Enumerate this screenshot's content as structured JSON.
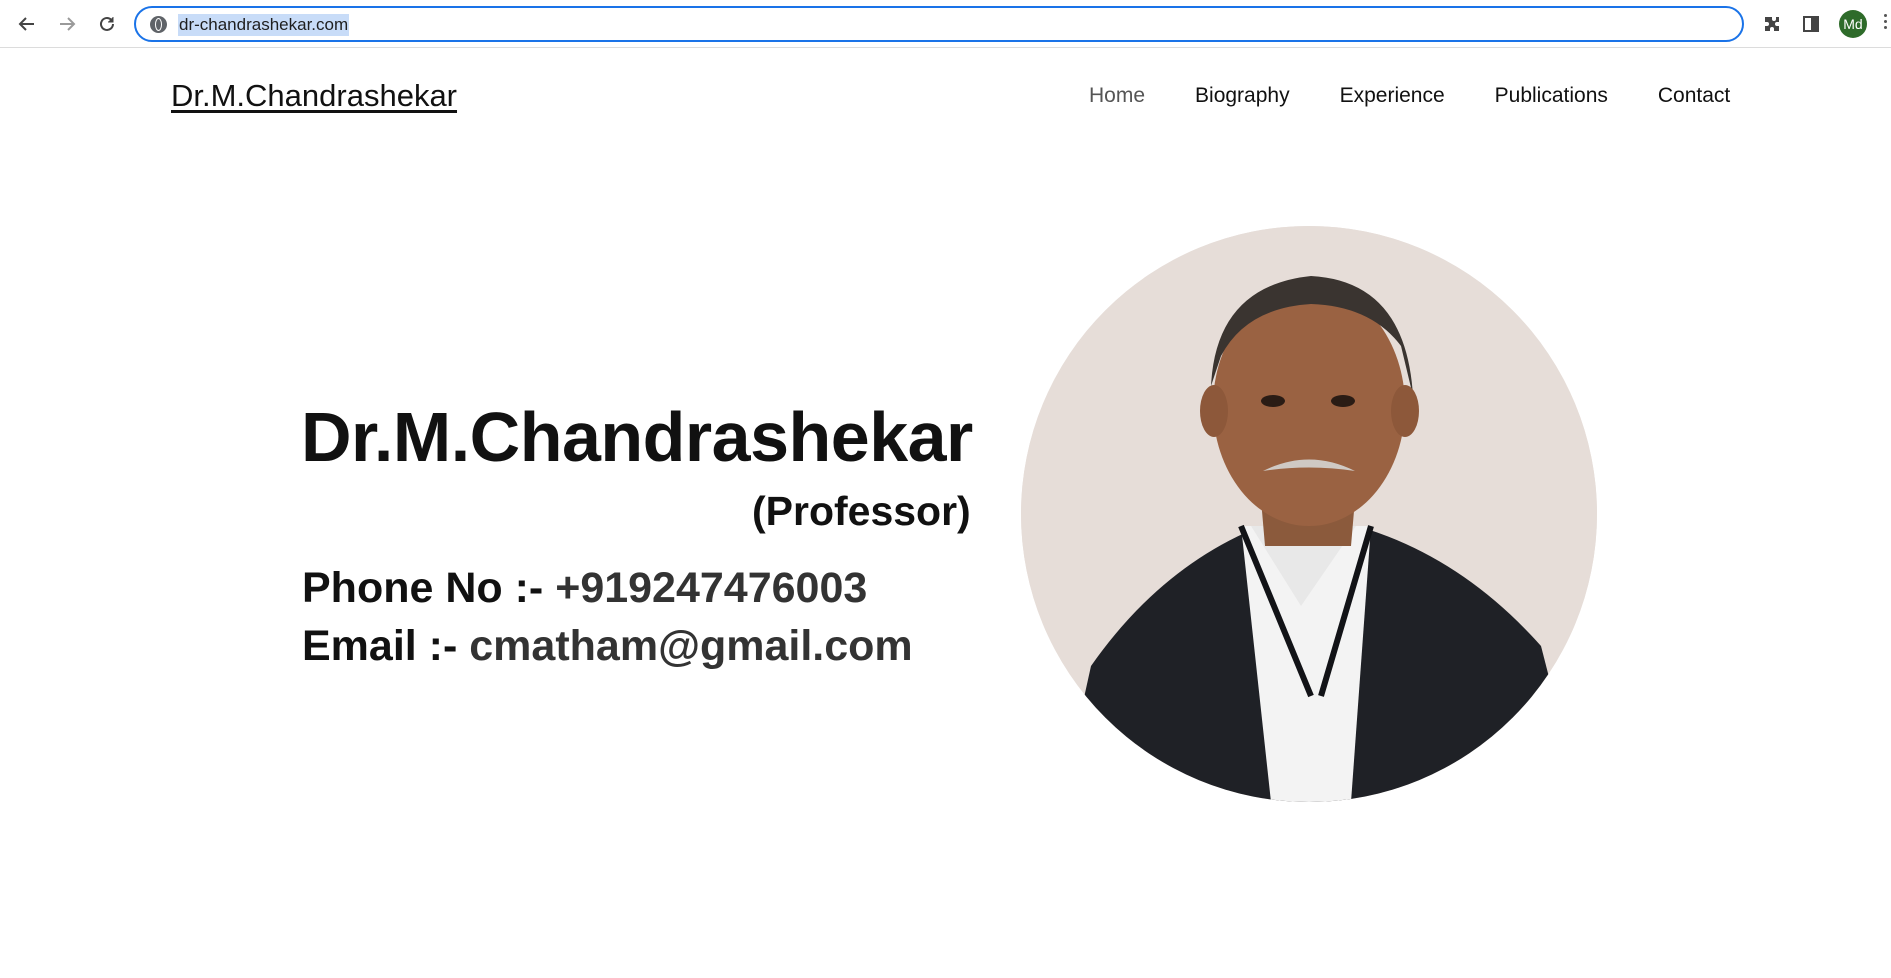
{
  "browser": {
    "url": "dr-chandrashekar.com",
    "profile_initials": "Md",
    "icons": [
      "back-icon",
      "forward-icon",
      "reload-icon",
      "site-info-icon",
      "extensions-icon",
      "side-panel-icon",
      "profile-avatar"
    ]
  },
  "site": {
    "brand": "Dr.M.Chandrashekar",
    "nav": [
      {
        "label": "Home",
        "active": true
      },
      {
        "label": "Biography",
        "active": false
      },
      {
        "label": "Experience",
        "active": false
      },
      {
        "label": "Publications",
        "active": false
      },
      {
        "label": "Contact",
        "active": false
      }
    ]
  },
  "hero": {
    "name": "Dr.M.Chandrashekar",
    "title": "(Professor)",
    "phone_label": "Phone No :-",
    "phone_value": "+919247476003",
    "email_label": "Email :-",
    "email_value": "cmatham@gmail.com"
  },
  "colors": {
    "accent": "#1a73e8",
    "url_highlight": "#c8dcf8",
    "avatar_bg": "#2e6b2a",
    "portrait_bg": "#e7dfdb"
  }
}
